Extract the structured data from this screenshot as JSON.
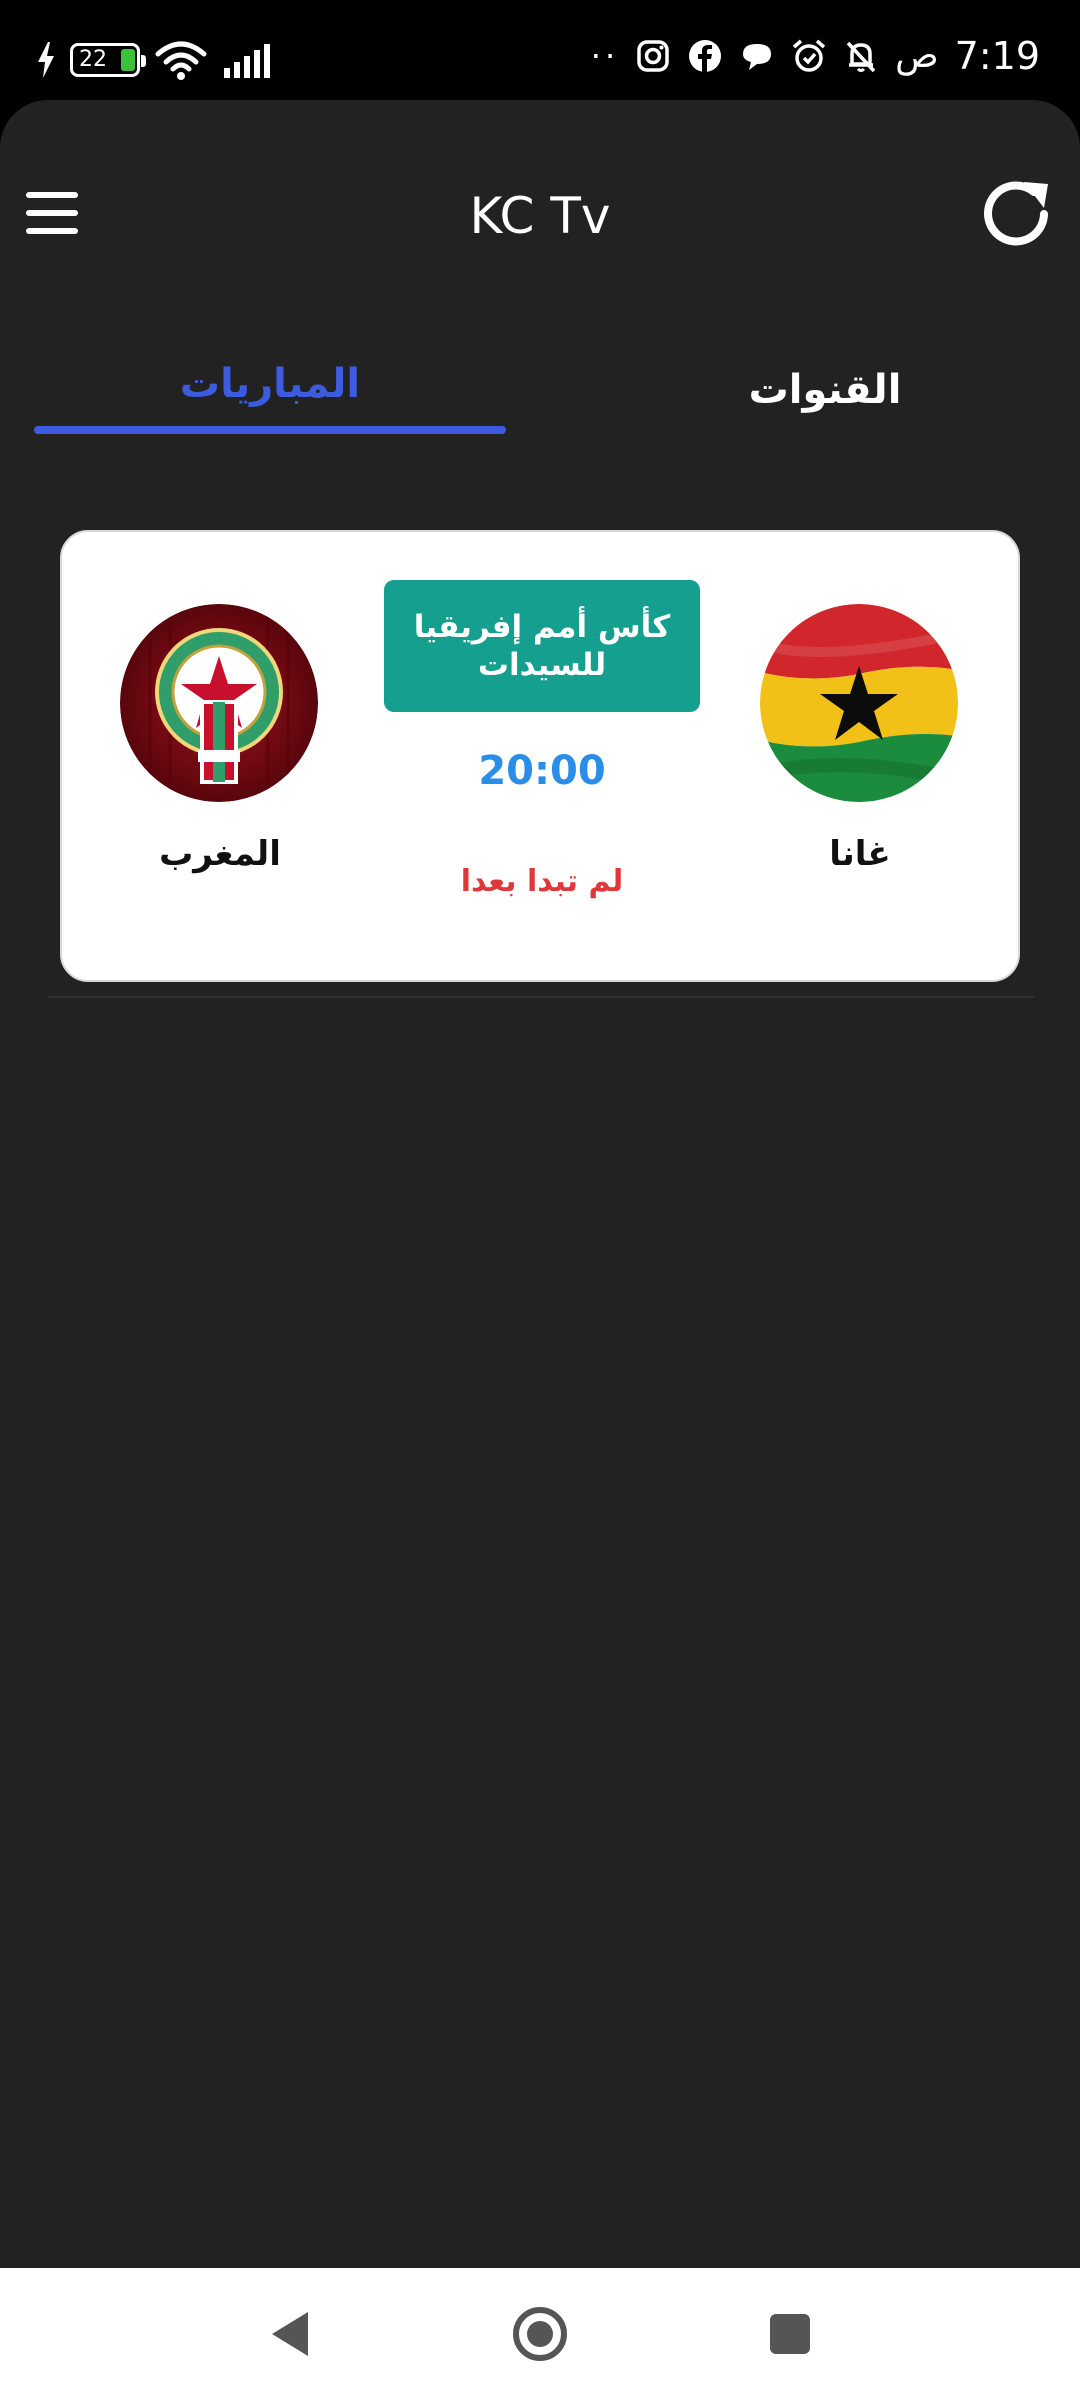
{
  "status_bar": {
    "battery_level": "22",
    "time": "7:19",
    "ampm": "ص",
    "dots": "··",
    "icons": [
      "charging-icon",
      "battery-icon",
      "wifi-icon",
      "signal-icon",
      "instagram-icon",
      "facebook-icon",
      "chat-icon",
      "alarm-icon",
      "mute-icon"
    ]
  },
  "header": {
    "title": "KC Tv",
    "icons": [
      "menu-icon",
      "refresh-icon"
    ]
  },
  "tabs": [
    {
      "label": "المباريات",
      "active": true
    },
    {
      "label": "القنوات",
      "active": false
    }
  ],
  "match": {
    "league": "كأس أمم إفريقيا للسيدات",
    "time": "20:00",
    "status": "لم تبدا بعدا",
    "home_team": {
      "name": "غانا",
      "logo": "ghana-flag-icon"
    },
    "away_team": {
      "name": "المغرب",
      "logo": "frmf-crest-icon"
    }
  },
  "colors": {
    "background": "#222222",
    "tab_active": "#3d5be0",
    "league_badge": "#149f8e",
    "time": "#2a8ee8",
    "status": "#e0383a"
  },
  "nav_bar": {
    "icons": [
      "back-icon",
      "home-icon",
      "recents-icon"
    ]
  }
}
